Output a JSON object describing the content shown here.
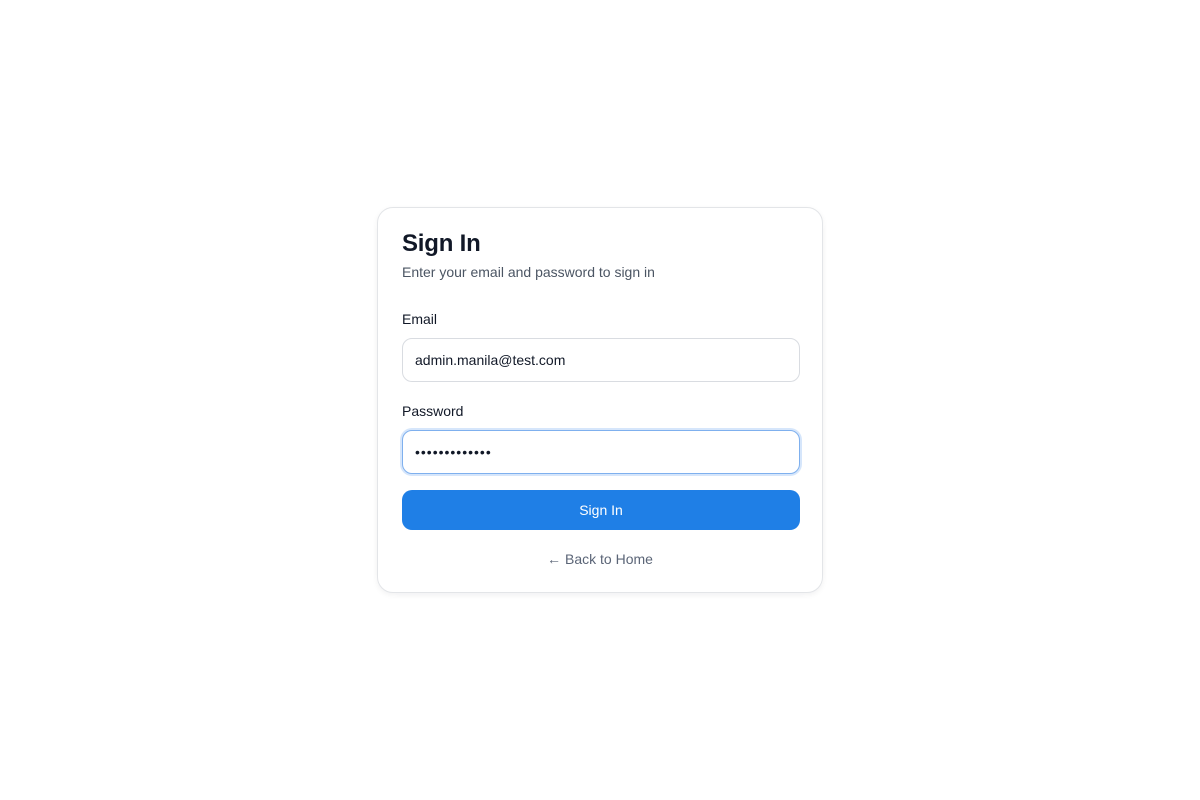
{
  "signin": {
    "title": "Sign In",
    "subtitle": "Enter your email and password to sign in",
    "email": {
      "label": "Email",
      "value": "admin.manila@test.com"
    },
    "password": {
      "label": "Password",
      "value": "•••••••••••••"
    },
    "submit_label": "Sign In",
    "back_link": {
      "icon": "←",
      "label": "Back to Home"
    }
  },
  "colors": {
    "accent": "#1f7fe6",
    "focus_ring": "#7fb0ee"
  }
}
